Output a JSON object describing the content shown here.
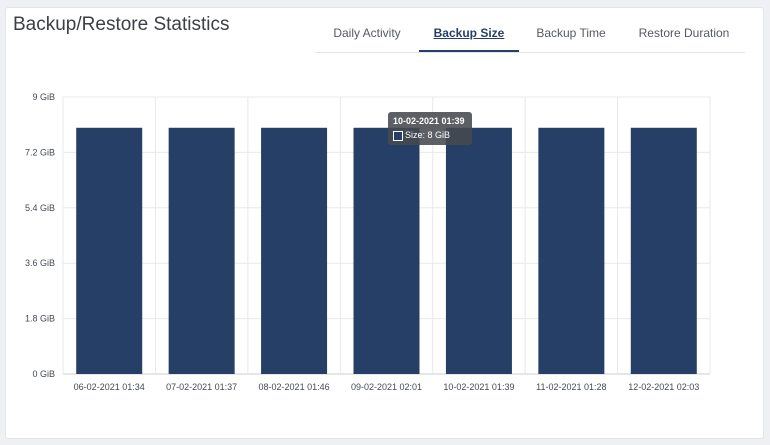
{
  "page": {
    "title": "Backup/Restore Statistics"
  },
  "tabs": [
    {
      "label": "Daily Activity",
      "active": false
    },
    {
      "label": "Backup Size",
      "active": true
    },
    {
      "label": "Backup Time",
      "active": false
    },
    {
      "label": "Restore Duration",
      "active": false
    }
  ],
  "colors": {
    "bar": "#253f66",
    "grid": "#e6e8eb",
    "axis": "#c9ccd1"
  },
  "tooltip": {
    "title": "10-02-2021 01:39",
    "series_label": "Size: 8 GiB"
  },
  "chart_data": {
    "type": "bar",
    "categories": [
      "06-02-2021 01:34",
      "07-02-2021 01:37",
      "08-02-2021 01:46",
      "09-02-2021 02:01",
      "10-02-2021 01:39",
      "11-02-2021 01:28",
      "12-02-2021 02:03"
    ],
    "series": [
      {
        "name": "Size",
        "values": [
          8,
          8,
          8,
          8,
          8,
          8,
          8
        ]
      }
    ],
    "unit": "GiB",
    "ylim": [
      0,
      9
    ],
    "yticks": [
      0,
      1.8,
      3.6,
      5.4,
      7.2,
      9
    ],
    "ytick_labels": [
      "0 GiB",
      "1.8 GiB",
      "3.6 GiB",
      "5.4 GiB",
      "7.2 GiB",
      "9 GiB"
    ],
    "grid": true,
    "title": "",
    "xlabel": "",
    "ylabel": ""
  }
}
